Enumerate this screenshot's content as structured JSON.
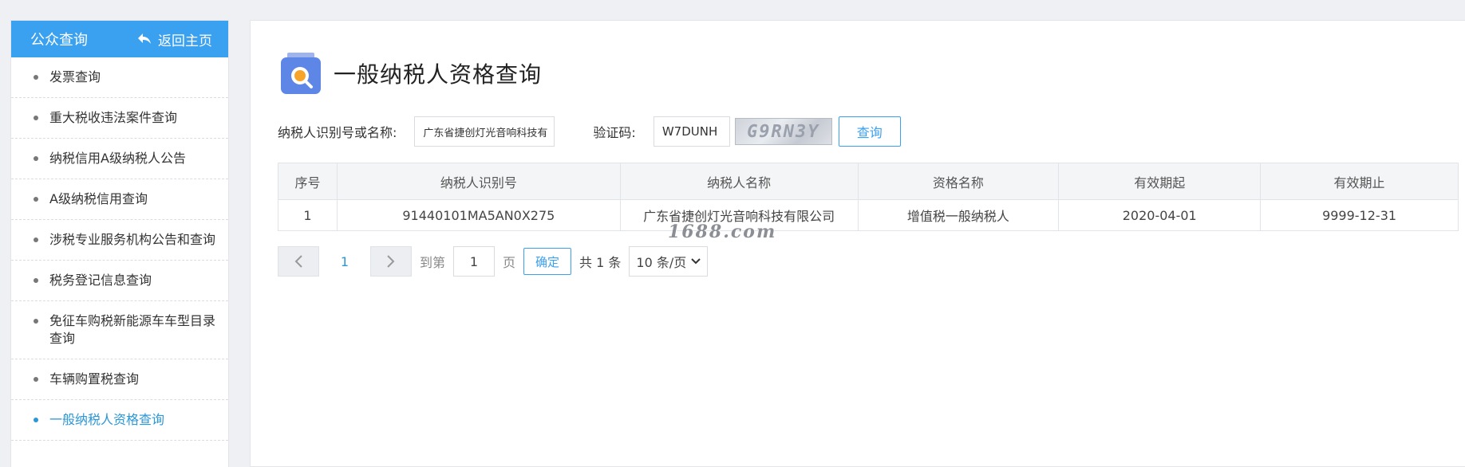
{
  "sidebar": {
    "header_title": "公众查询",
    "back_label": "返回主页",
    "items": [
      {
        "label": "发票查询"
      },
      {
        "label": "重大税收违法案件查询"
      },
      {
        "label": "纳税信用A级纳税人公告"
      },
      {
        "label": "A级纳税信用查询"
      },
      {
        "label": "涉税专业服务机构公告和查询"
      },
      {
        "label": "税务登记信息查询"
      },
      {
        "label": "免征车购税新能源车车型目录查询"
      },
      {
        "label": "车辆购置税查询"
      },
      {
        "label": "一般纳税人资格查询",
        "active": true
      }
    ]
  },
  "page": {
    "title": "一般纳税人资格查询"
  },
  "form": {
    "taxpayer_label": "纳税人识别号或名称:",
    "taxpayer_value": "广东省捷创灯光音响科技有",
    "captcha_label": "验证码:",
    "captcha_value": "W7DUNH",
    "captcha_image_text": "G9RN3Y",
    "query_button": "查询"
  },
  "table": {
    "headers": [
      "序号",
      "纳税人识别号",
      "纳税人名称",
      "资格名称",
      "有效期起",
      "有效期止"
    ],
    "rows": [
      [
        "1",
        "91440101MA5AN0X275",
        "广东省捷创灯光音响科技有限公司",
        "增值税一般纳税人",
        "2020-04-01",
        "9999-12-31"
      ]
    ]
  },
  "pagination": {
    "current_page": "1",
    "goto_label": "到第",
    "goto_value": "1",
    "page_unit": "页",
    "confirm_label": "确定",
    "total_label": "共 1 条",
    "page_size": "10 条/页"
  },
  "watermark": "1688.com",
  "colors": {
    "accent": "#3aa0f0",
    "active_link": "#2b97d6",
    "background": "#eef0f3"
  }
}
